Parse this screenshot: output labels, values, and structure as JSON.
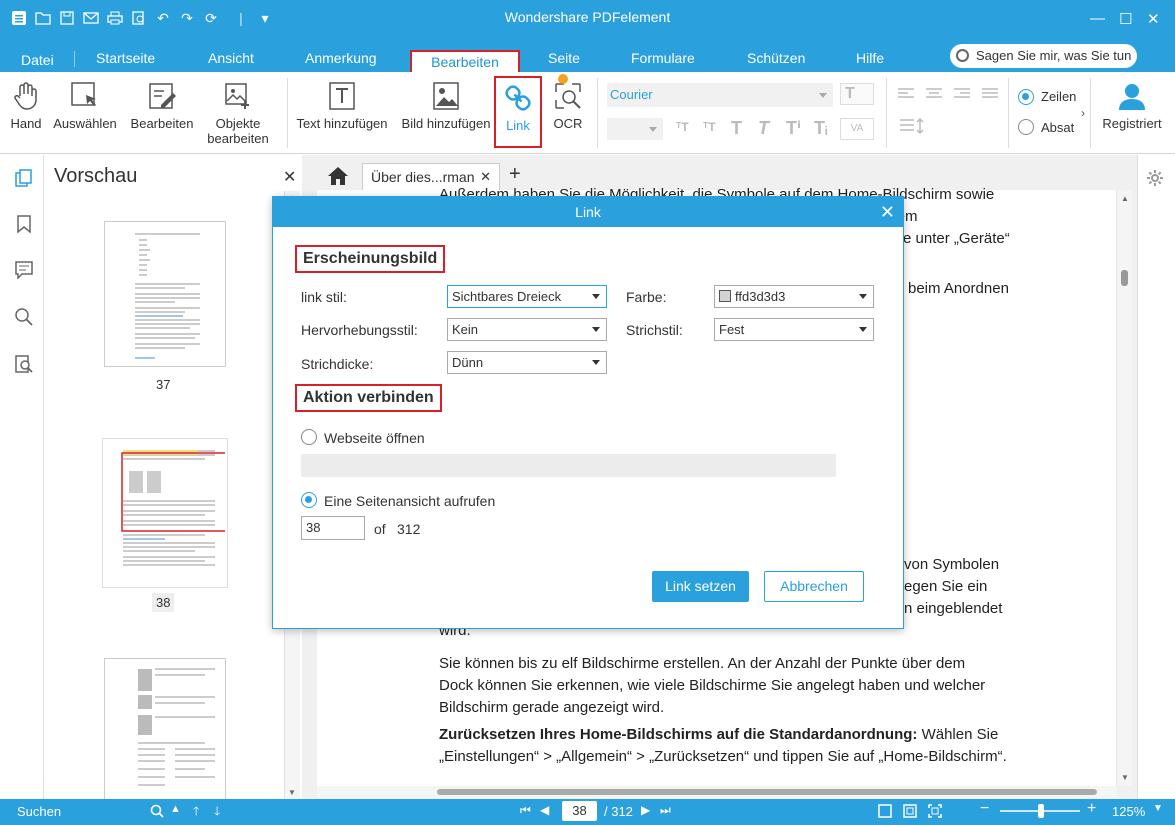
{
  "window": {
    "title": "Wondershare PDFelement"
  },
  "menu": {
    "tabs": [
      "Datei",
      "Startseite",
      "Ansicht",
      "Anmerkung",
      "Bearbeiten",
      "Seite",
      "Formulare",
      "Schützen",
      "Hilfe"
    ],
    "active_tab": "Bearbeiten",
    "search_placeholder": "Sagen Sie mir, was Sie tun"
  },
  "ribbon": {
    "hand": "Hand",
    "select": "Auswählen",
    "edit": "Bearbeiten",
    "edit_objects_1": "Objekte",
    "edit_objects_2": "bearbeiten",
    "add_text": "Text hinzufügen",
    "add_image": "Bild hinzufügen",
    "link": "Link",
    "ocr": "OCR",
    "font": "Courier",
    "line_mode": "Zeilen",
    "paragraph_mode": "Absat",
    "registered": "Registriert"
  },
  "preview": {
    "title": "Vorschau",
    "pages": [
      "37",
      "38"
    ]
  },
  "doc_tab": {
    "label": "Über dies...rman"
  },
  "document": {
    "line1": "Außerdem haben Sie die Möglichkeit, die Symbole auf dem Home-Bildschirm sowie",
    "line2": "mit Ihrem",
    "line3": "e unter „Geräte“",
    "line4": "beim Anordnen",
    "line5": "von Symbolen",
    "line6": "egen Sie ein",
    "line7": "n eingeblendet",
    "line8": "wird.",
    "para2_1": "Sie können bis zu elf Bildschirme erstellen. An der Anzahl der Punkte über dem",
    "para2_2": "Dock können Sie erkennen, wie viele Bildschirme Sie angelegt haben und welcher",
    "para2_3": "Bildschirm gerade angezeigt wird.",
    "para3_bold": "Zurücksetzen Ihres Home-Bildschirms auf die Standardanordnung:",
    "para3_rest": " Wählen Sie",
    "para3_2": "„Einstellungen“ > „Allgemein“ > „Zurücksetzen“ und tippen Sie auf „Home-Bildschirm“."
  },
  "dialog": {
    "title": "Link",
    "appearance_title": "Erscheinungsbild",
    "link_style_label": "link stil:",
    "link_style_value": "Sichtbares Dreieck",
    "color_label": "Farbe:",
    "color_value": "ffd3d3d3",
    "highlight_label": "Hervorhebungsstil:",
    "highlight_value": "Kein",
    "line_style_label": "Strichstil:",
    "line_style_value": "Fest",
    "line_width_label": "Strichdicke:",
    "line_width_value": "Dünn",
    "action_title": "Aktion verbinden",
    "open_web": "Webseite öffnen",
    "goto_page": "Eine Seitenansicht aufrufen",
    "page_value": "38",
    "of_label": "of",
    "page_total": "312",
    "set_link": "Link setzen",
    "cancel": "Abbrechen"
  },
  "status": {
    "search": "Suchen",
    "current_page": "38",
    "total_pages": "/ 312",
    "zoom": "125%"
  },
  "colors": {
    "accent": "#2aa0dc",
    "highlight_border": "#d8202a"
  }
}
